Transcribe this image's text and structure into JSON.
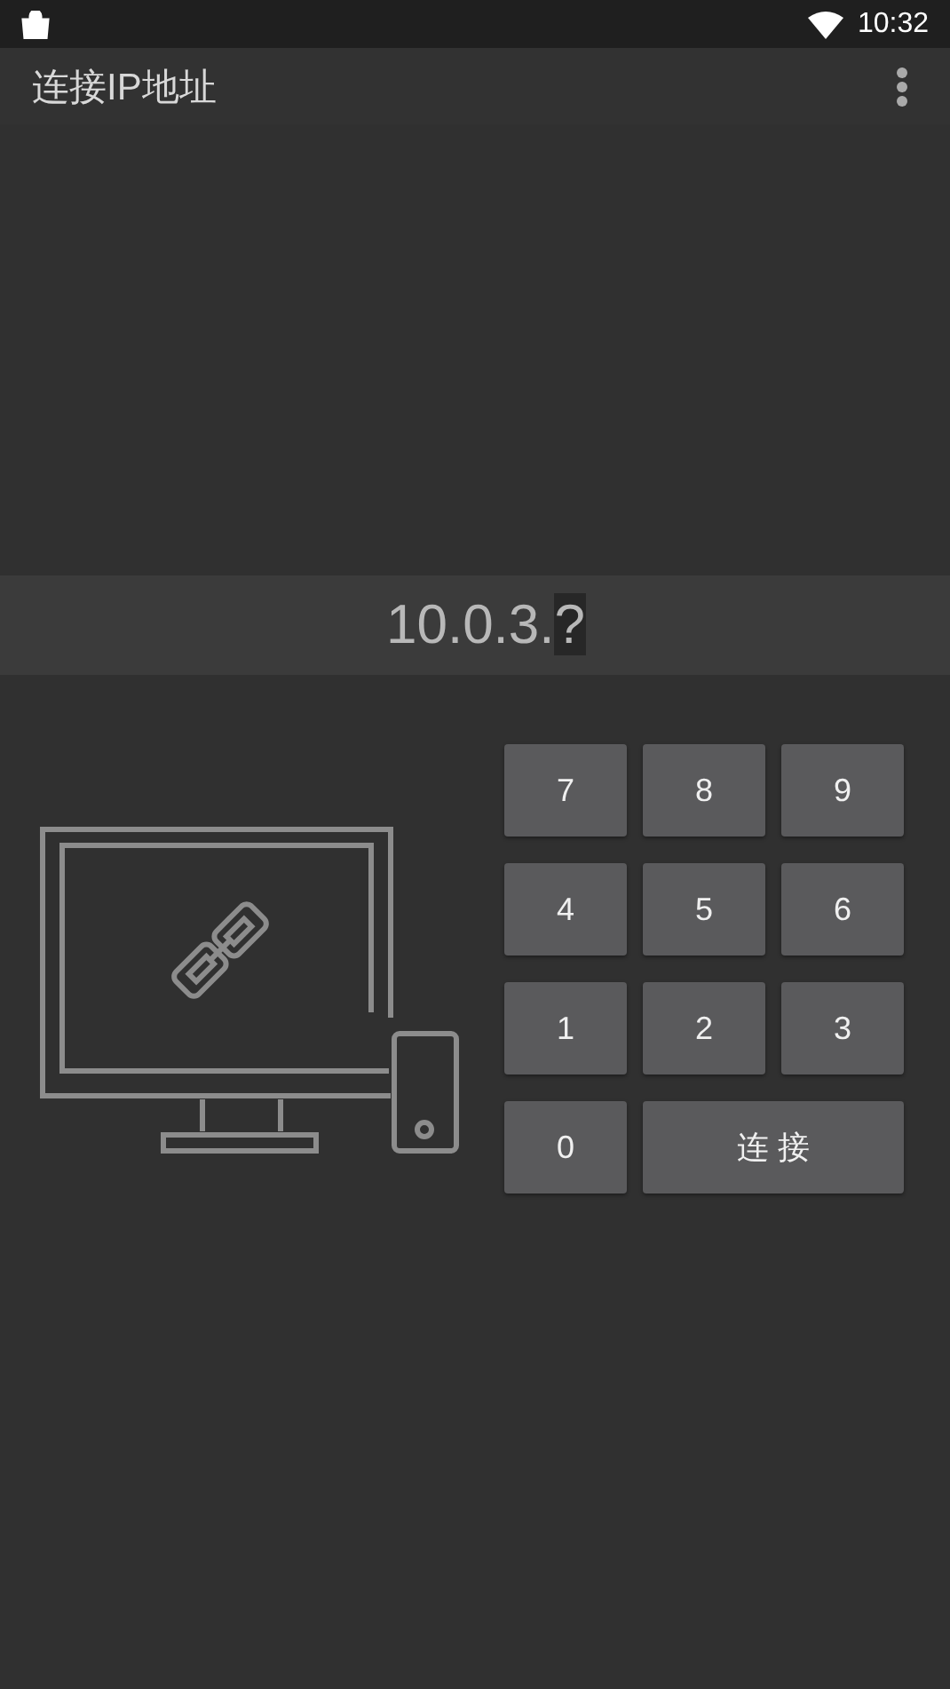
{
  "status_bar": {
    "time": "10:32"
  },
  "app_bar": {
    "title": "连接IP地址"
  },
  "ip_display": {
    "value": "10.0.3.",
    "cursor_text": "?"
  },
  "keys": [
    {
      "kind": "digit",
      "label": "7"
    },
    {
      "kind": "digit",
      "label": "8"
    },
    {
      "kind": "digit",
      "label": "9"
    },
    {
      "kind": "digit",
      "label": "4"
    },
    {
      "kind": "digit",
      "label": "5"
    },
    {
      "kind": "digit",
      "label": "6"
    },
    {
      "kind": "digit",
      "label": "1"
    },
    {
      "kind": "digit",
      "label": "2"
    },
    {
      "kind": "digit",
      "label": "3"
    },
    {
      "kind": "digit",
      "label": "0"
    },
    {
      "kind": "connect",
      "label": "连 接"
    }
  ]
}
